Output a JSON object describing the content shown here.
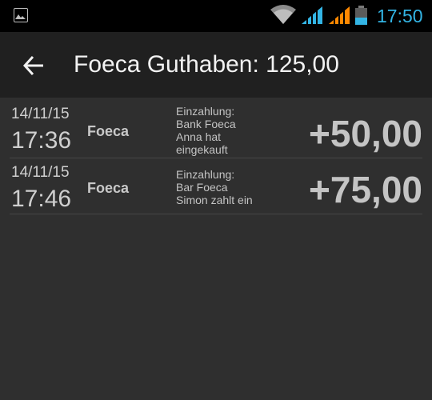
{
  "status_bar": {
    "time": "17:50",
    "icons": [
      "image-notification-icon",
      "wifi-icon",
      "signal-icon",
      "signal-icon",
      "battery-icon"
    ],
    "accent_color": "#33b5e5",
    "signal2_color": "#ff8800"
  },
  "action_bar": {
    "title": "Foeca Guthaben: 125,00",
    "back_icon": "arrow-left-icon"
  },
  "transactions": [
    {
      "date": "14/11/15",
      "time": "17:36",
      "account": "Foeca",
      "description": [
        "Einzahlung:",
        "Bank Foeca",
        "Anna hat",
        "eingekauft"
      ],
      "amount": "+50,00"
    },
    {
      "date": "14/11/15",
      "time": "17:46",
      "account": "Foeca",
      "description": [
        "Einzahlung:",
        "Bar Foeca",
        "Simon zahlt ein"
      ],
      "amount": "+75,00"
    }
  ]
}
